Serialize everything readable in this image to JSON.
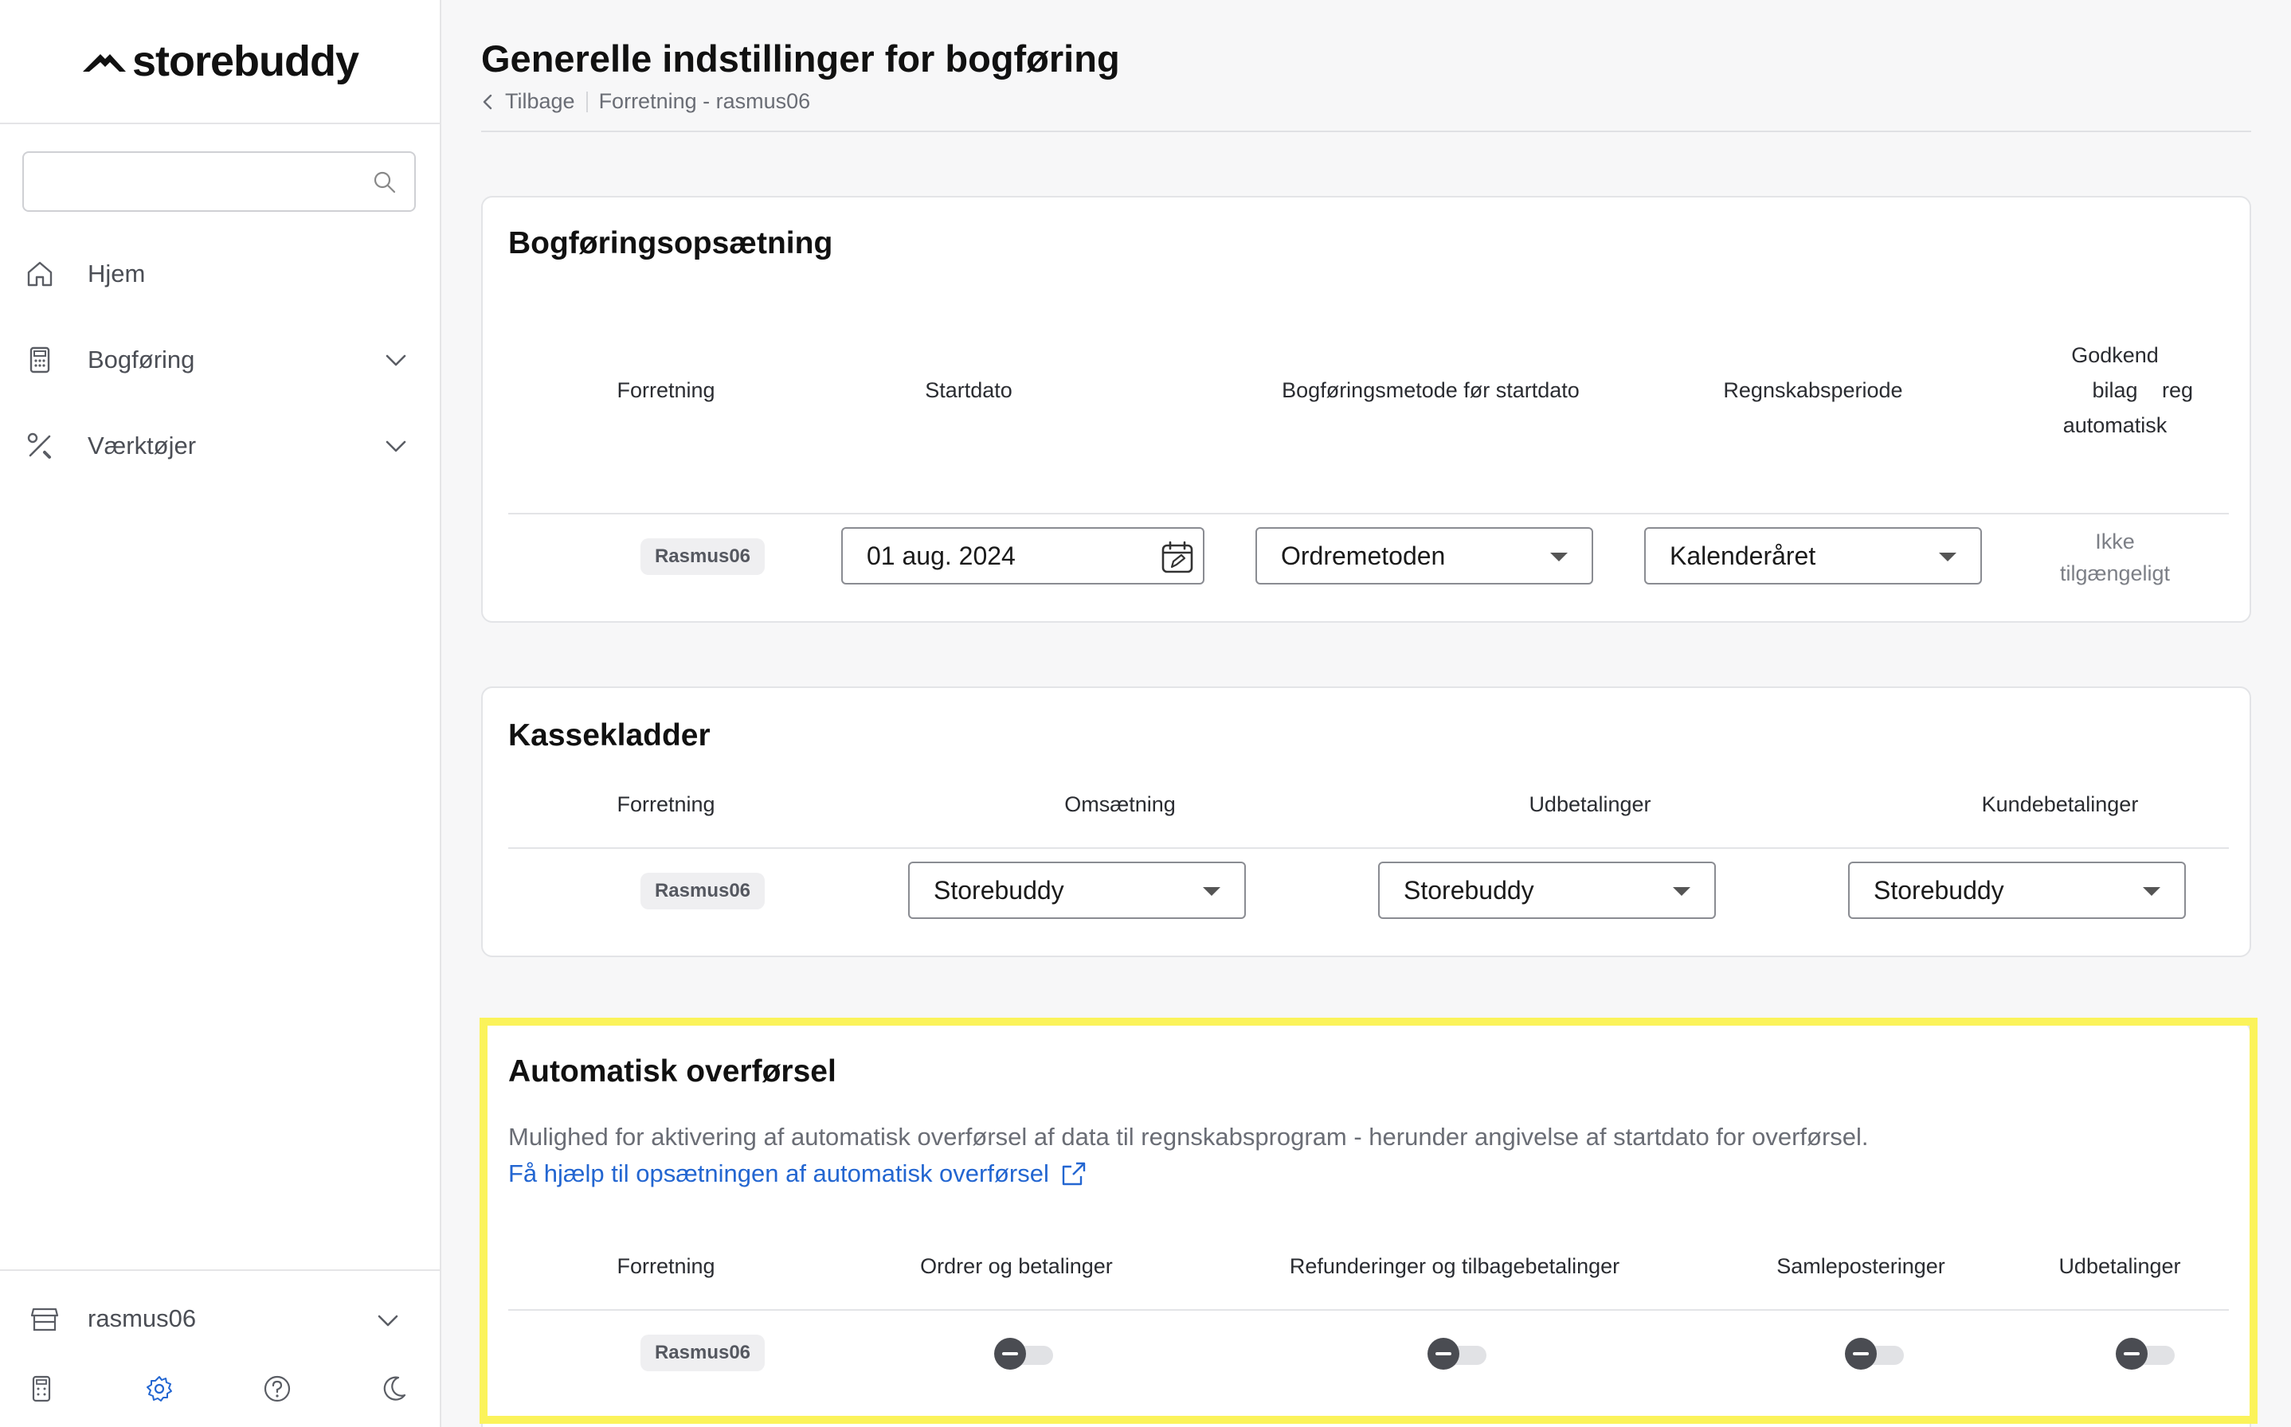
{
  "brand": {
    "name": "storebuddy"
  },
  "sidebar": {
    "search": {
      "placeholder": ""
    },
    "items": [
      {
        "label": "Hjem",
        "icon": "home-icon"
      },
      {
        "label": "Bogføring",
        "icon": "calculator-icon"
      },
      {
        "label": "Værktøjer",
        "icon": "tools-icon"
      }
    ],
    "store": {
      "label": "rasmus06",
      "icon": "store-icon"
    }
  },
  "header": {
    "title": "Generelle indstillinger for bogføring",
    "breadcrumb": {
      "back": "Tilbage",
      "current": "Forretning - rasmus06"
    }
  },
  "setup": {
    "title": "Bogføringsopsætning",
    "columns": [
      "Forretning",
      "Startdato",
      "Bogføringsmetode før startdato",
      "Regnskabsperiode",
      "Godkend bilag automatisk",
      "reg"
    ],
    "row": {
      "store": "Rasmus06",
      "start_date": "01 aug. 2024",
      "method": "Ordremetoden",
      "period": "Kalenderåret",
      "approve": "Ikke tilgængeligt"
    }
  },
  "journals": {
    "title": "Kassekladder",
    "columns": [
      "Forretning",
      "Omsætning",
      "Udbetalinger",
      "Kundebetalinger"
    ],
    "row": {
      "store": "Rasmus06",
      "revenue": "Storebuddy",
      "payouts": "Storebuddy",
      "customer_payments": "Storebuddy"
    }
  },
  "auto_transfer": {
    "title": "Automatisk overførsel",
    "description": "Mulighed for aktivering af automatisk overførsel af data til regnskabsprogram - herunder angivelse af startdato for overførsel.",
    "help_link": "Få hjælp til opsætningen af automatisk overførsel",
    "columns": [
      "Forretning",
      "Ordrer og betalinger",
      "Refunderinger og tilbagebetalinger",
      "Samleposteringer",
      "Udbetalinger"
    ],
    "row": {
      "store": "Rasmus06",
      "orders": false,
      "refunds": false,
      "collective": false,
      "payouts": false
    }
  },
  "colors": {
    "accent": "#2366d1",
    "highlight": "#fbf35a",
    "toggle_off": "#4a4c52"
  }
}
